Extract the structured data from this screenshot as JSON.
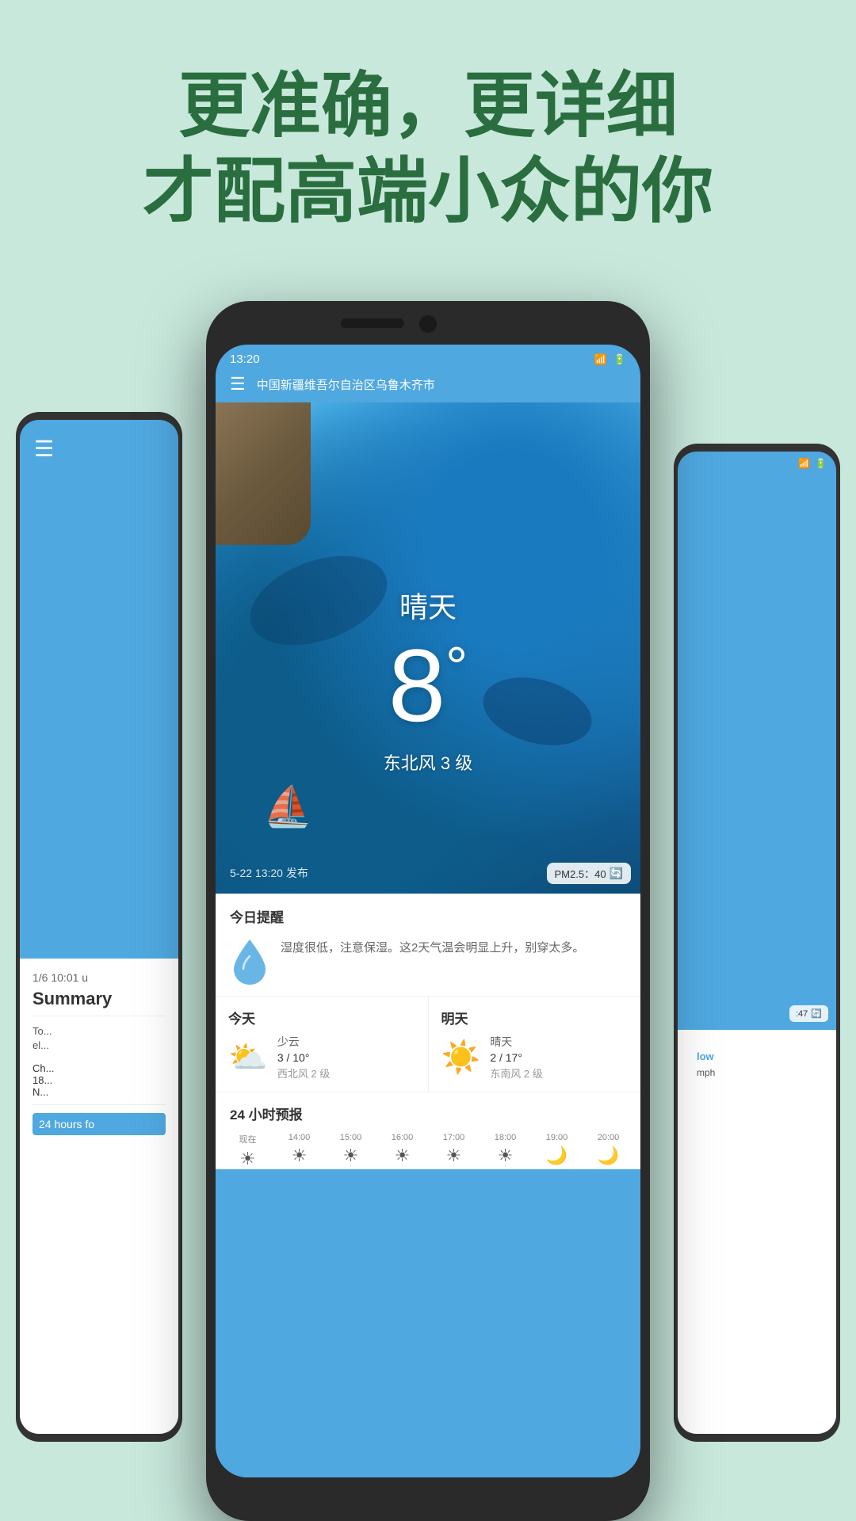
{
  "page": {
    "background_color": "#c8e8dc"
  },
  "heading": {
    "line1": "更准确，更详细",
    "line2": "才配高端小众的你"
  },
  "phone_main": {
    "status_bar": {
      "time": "13:20",
      "wifi": "WiFi",
      "battery": "Bat"
    },
    "location": "中国新疆维吾尔自治区乌鲁木齐市",
    "weather": {
      "condition": "晴天",
      "temperature": "8",
      "wind": "东北风 3 级",
      "publish_time": "5-22 13:20 发布",
      "pm_label": "PM2.5：40"
    },
    "reminder": {
      "title": "今日提醒",
      "text": "湿度很低，注意保湿。这2天气温会明显上升，别穿太多。"
    },
    "today": {
      "label": "今天",
      "condition": "少云",
      "temp_range": "3 / 10°",
      "wind": "西北风 2 级"
    },
    "tomorrow": {
      "label": "明天",
      "condition": "晴天",
      "temp_range": "2 / 17°",
      "wind": "东南风 2 级"
    },
    "hourly": {
      "title": "24 小时预报",
      "hours": [
        {
          "time": "现在",
          "icon": "☀"
        },
        {
          "time": "14:00",
          "icon": "☀"
        },
        {
          "time": "15:00",
          "icon": "☀"
        },
        {
          "time": "16:00",
          "icon": "☀"
        },
        {
          "time": "17:00",
          "icon": "☀"
        },
        {
          "time": "18:00",
          "icon": "☀"
        },
        {
          "time": "19:00",
          "icon": "🌙"
        },
        {
          "time": "20:00",
          "icon": "🌙"
        }
      ]
    }
  },
  "phone_left": {
    "menu_icon": "☰",
    "date_label": "1/6 10:01 u",
    "summary_label": "Summary",
    "summary_text": "To... el...",
    "weather_row": "Ch... 18... N...",
    "hours_label": "24 hours fo"
  },
  "phone_right": {
    "pm_label": ":47",
    "hours_row": "low",
    "value_row": "mph"
  }
}
